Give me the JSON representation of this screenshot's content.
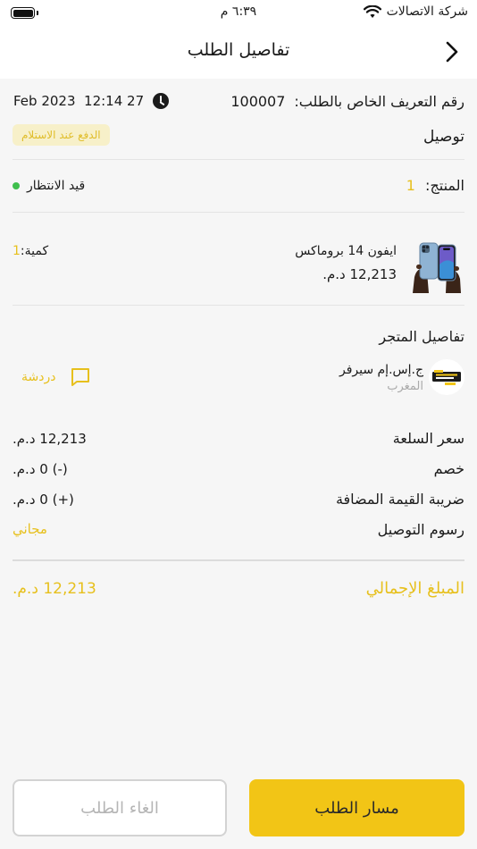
{
  "status_bar": {
    "carrier": "شركة الاتصالات",
    "time": "٦:٣٩ م"
  },
  "header": {
    "title": "تفاصيل الطلب"
  },
  "order": {
    "id_label": "رقم التعريف الخاص بالطلب:",
    "id_value": "100007",
    "datetime": "Feb 2023  12:14 27",
    "delivery_type": "توصيل",
    "payment_badge": "الدفع عند الاستلام",
    "product_label": "المنتج:",
    "product_count": "1",
    "status": "قيد الانتظار",
    "status_color": "#3fbf4d"
  },
  "product": {
    "name": "ايفون 14 بروماكس",
    "price": "12,213 د.م.",
    "qty_label": "كمية:",
    "qty_value": "1"
  },
  "store": {
    "section_title": "تفاصيل المتجر",
    "name": "ج.إس.إم سيرفر",
    "country": "المغرب",
    "chat_label": "دردشة"
  },
  "summary": [
    {
      "label": "سعر السلعة",
      "value": "12,213 د.م."
    },
    {
      "label": "خصم",
      "value": "(-) 0 د.م."
    },
    {
      "label": "ضريبة القيمة المضافة",
      "value": "(+) 0 د.م."
    },
    {
      "label": "رسوم التوصيل",
      "value": "مجاني"
    }
  ],
  "total": {
    "label": "المبلغ الإجمالي",
    "value": "12,213 د.م."
  },
  "actions": {
    "track_label": "مسار الطلب",
    "cancel_label": "الغاء الطلب"
  },
  "colors": {
    "accent": "#f2c516",
    "accent_text": "#e7c01d",
    "background": "#f6f6f6"
  }
}
